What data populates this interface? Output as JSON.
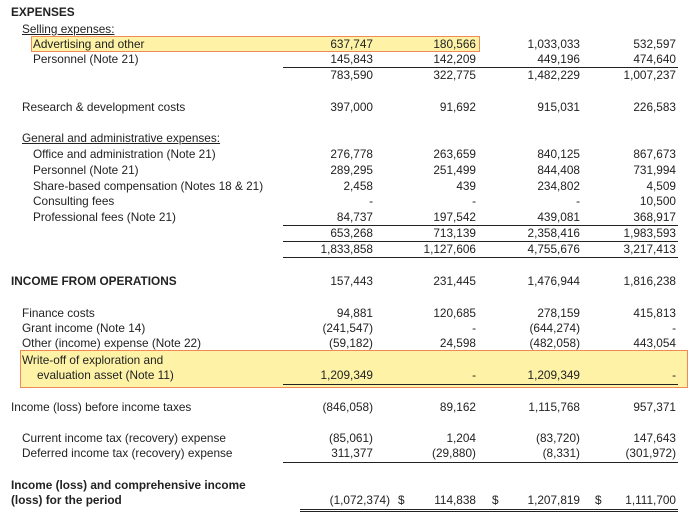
{
  "colors": {
    "highlight": "#fdf2a6",
    "highlight_border": "#ef8a57"
  },
  "heading": "EXPENSES",
  "selling": {
    "label": "Selling expenses:",
    "rows": [
      {
        "label": "Advertising and other",
        "values": [
          "637,747",
          "180,566",
          "1,033,033",
          "532,597"
        ]
      },
      {
        "label": "Personnel (Note 21)",
        "values": [
          "145,843",
          "142,209",
          "449,196",
          "474,640"
        ]
      }
    ],
    "subtotal": [
      "783,590",
      "322,775",
      "1,482,229",
      "1,007,237"
    ]
  },
  "research": {
    "label": "Research & development costs",
    "values": [
      "397,000",
      "91,692",
      "915,031",
      "226,583"
    ]
  },
  "ga": {
    "label": "General and administrative expenses:",
    "rows": [
      {
        "label": "Office and administration (Note 21)",
        "values": [
          "276,778",
          "263,659",
          "840,125",
          "867,673"
        ]
      },
      {
        "label": "Personnel (Note 21)",
        "values": [
          "289,295",
          "251,499",
          "844,408",
          "731,994"
        ]
      },
      {
        "label": "Share-based compensation (Notes 18 & 21)",
        "values": [
          "2,458",
          "439",
          "234,802",
          "4,509"
        ]
      },
      {
        "label": "Consulting fees",
        "values": [
          "-",
          "-",
          "-",
          "10,500"
        ]
      },
      {
        "label": "Professional fees (Note 21)",
        "values": [
          "84,737",
          "197,542",
          "439,081",
          "368,917"
        ]
      }
    ],
    "subtotal": [
      "653,268",
      "713,139",
      "2,358,416",
      "1,983,593"
    ],
    "total": [
      "1,833,858",
      "1,127,606",
      "4,755,676",
      "3,217,413"
    ]
  },
  "operations": {
    "label": "INCOME FROM OPERATIONS",
    "values": [
      "157,443",
      "231,445",
      "1,476,944",
      "1,816,238"
    ]
  },
  "other": {
    "rows": [
      {
        "label": "Finance costs",
        "values": [
          "94,881",
          "120,685",
          "278,159",
          "415,813"
        ]
      },
      {
        "label": "Grant income (Note 14)",
        "values": [
          "(241,547)",
          "-",
          "(644,274)",
          "-"
        ]
      },
      {
        "label": "Other (income) expense (Note 22)",
        "values": [
          "(59,182)",
          "24,598",
          "(482,058)",
          "443,054"
        ]
      }
    ],
    "writeoff": {
      "label_line1": "Write-off of exploration and",
      "label_line2": "evaluation asset (Note 11)",
      "values": [
        "1,209,349",
        "-",
        "1,209,349",
        "-"
      ]
    }
  },
  "pretax": {
    "label": "Income (loss) before income taxes",
    "values": [
      "(846,058)",
      "89,162",
      "1,115,768",
      "957,371"
    ]
  },
  "tax": {
    "rows": [
      {
        "label": "Current income tax (recovery) expense",
        "values": [
          "(85,061)",
          "1,204",
          "(83,720)",
          "147,643"
        ]
      },
      {
        "label": "Deferred income tax (recovery) expense",
        "values": [
          "311,377",
          "(29,880)",
          "(8,331)",
          "(301,972)"
        ]
      }
    ]
  },
  "final": {
    "label_line1": "Income (loss) and comprehensive income",
    "label_line2": "(loss) for the period",
    "values": [
      "(1,072,374)",
      "114,838",
      "1,207,819",
      "1,111,700"
    ],
    "currency": "$"
  }
}
